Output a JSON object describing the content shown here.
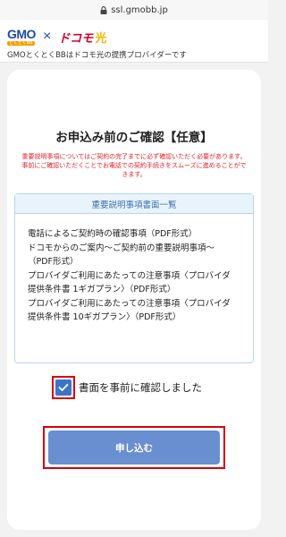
{
  "browser": {
    "url": "ssl.gmobb.jp"
  },
  "header": {
    "gmo_logo_text": "GMO",
    "gmo_logo_sub": "とくとくBB",
    "separator": "×",
    "docomo_text": "ドコモ",
    "hikari_text": "光",
    "tagline": "GMOとくとくBBはドコモ光の提携プロバイダーです"
  },
  "main": {
    "title": "お申込み前のご確認【任意】",
    "warning_lines": [
      "重要説明事項についてはご契約の完了までに必ず確認いただく必要があります。",
      "事前にご確認いただくことでお電話での契約手続きをスムーズに進めることがで",
      "きます。"
    ],
    "docs": {
      "heading": "重要説明事項書面一覧",
      "lines": [
        "電話によるご契約時の確認事項（PDF形式）",
        "ドコモからのご案内〜ご契約前の重要説明事項〜",
        "（PDF形式）",
        "プロバイダご利用にあたっての注意事項〈プロバイダ",
        "提供条件書 1ギガプラン〉（PDF形式）",
        "プロバイダご利用にあたっての注意事項〈プロバイダ",
        "提供条件書 10ギガプラン〉（PDF形式）"
      ]
    },
    "confirm_label": "書面を事前に確認しました",
    "confirm_checked": true,
    "submit_label": "申し込む"
  },
  "colors": {
    "accent_blue": "#3d74c6",
    "button_blue": "#6a8fd0",
    "warning_red": "#e0202a",
    "highlight_red": "#d8000c"
  }
}
